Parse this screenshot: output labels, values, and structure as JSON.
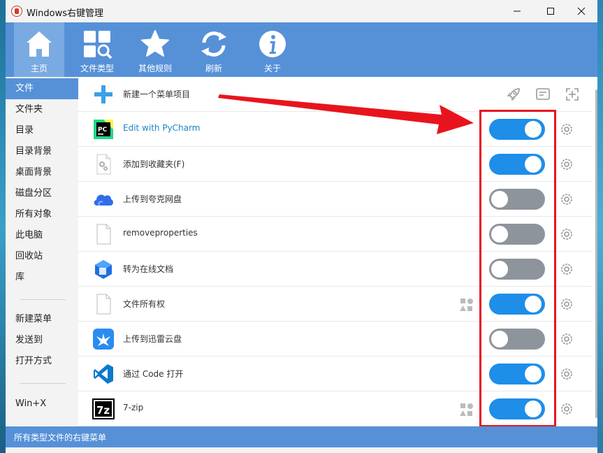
{
  "window": {
    "title": "Windows右键管理"
  },
  "toolbar": {
    "items": [
      {
        "label": "主页",
        "icon": "home-icon",
        "active": true
      },
      {
        "label": "文件类型",
        "icon": "file-types-icon",
        "active": false
      },
      {
        "label": "其他规则",
        "icon": "star-icon",
        "active": false
      },
      {
        "label": "刷新",
        "icon": "refresh-icon",
        "active": false
      },
      {
        "label": "关于",
        "icon": "info-icon",
        "active": false
      }
    ]
  },
  "sidebar": {
    "items": [
      {
        "label": "文件",
        "active": true
      },
      {
        "label": "文件夹"
      },
      {
        "label": "目录"
      },
      {
        "label": "目录背景"
      },
      {
        "label": "桌面背景"
      },
      {
        "label": "磁盘分区"
      },
      {
        "label": "所有对象"
      },
      {
        "label": "此电脑"
      },
      {
        "label": "回收站"
      },
      {
        "label": "库"
      },
      {
        "label": "新建菜单"
      },
      {
        "label": "发送到"
      },
      {
        "label": "打开方式"
      },
      {
        "label": "Win+X"
      }
    ]
  },
  "main": {
    "new_item": {
      "label": "新建一个菜单项目",
      "actions": [
        "rocket-icon",
        "note-icon",
        "add-target-icon"
      ]
    },
    "rows": [
      {
        "label": "Edit with PyCharm",
        "icon": "pycharm-icon",
        "enabled": true,
        "link": true
      },
      {
        "label": "添加到收藏夹(F)",
        "icon": "settings-file-icon",
        "enabled": true
      },
      {
        "label": "上传到夸克网盘",
        "icon": "quark-cloud-icon",
        "enabled": false
      },
      {
        "label": "removeproperties",
        "icon": "blank-file-icon",
        "enabled": false
      },
      {
        "label": "转为在线文档",
        "icon": "online-doc-icon",
        "enabled": false
      },
      {
        "label": "文件所有权",
        "icon": "blank-file-icon",
        "enabled": true,
        "permission": true
      },
      {
        "label": "上传到迅雷云盘",
        "icon": "thunder-cloud-icon",
        "enabled": false
      },
      {
        "label": "通过 Code 打开",
        "icon": "vscode-icon",
        "enabled": true
      },
      {
        "label": "7-zip",
        "icon": "7zip-icon",
        "enabled": true,
        "permission": true
      }
    ]
  },
  "status": {
    "text": "所有类型文件的右键菜单"
  },
  "colors": {
    "accent": "#5691d8",
    "toggle_on": "#1e8ee8",
    "toggle_off": "#8e949b",
    "highlight": "#e8141d"
  }
}
